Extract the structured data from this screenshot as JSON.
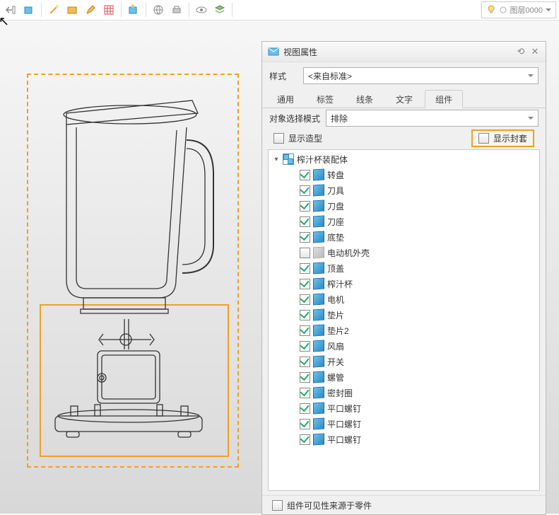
{
  "layer": {
    "label": "图层0000"
  },
  "panel": {
    "title": "视图属性",
    "style_label": "样式",
    "style_value": "<来自标准>",
    "tabs": [
      "通用",
      "标签",
      "线条",
      "文字",
      "组件"
    ],
    "active_tab": 4,
    "mode_label": "对象选择模式",
    "mode_value": "排除",
    "show_model": "显示造型",
    "show_envelope": "显示封套",
    "footer": "组件可见性来源于零件"
  },
  "tree": {
    "root": "榨汁杯装配体",
    "items": [
      {
        "label": "转盘",
        "checked": true
      },
      {
        "label": "刀具",
        "checked": true
      },
      {
        "label": "刀盘",
        "checked": true
      },
      {
        "label": "刀座",
        "checked": true
      },
      {
        "label": "底垫",
        "checked": true
      },
      {
        "label": "电动机外壳",
        "checked": false
      },
      {
        "label": "顶盖",
        "checked": true
      },
      {
        "label": "榨汁杯",
        "checked": true
      },
      {
        "label": "电机",
        "checked": true
      },
      {
        "label": "垫片",
        "checked": true
      },
      {
        "label": "垫片2",
        "checked": true
      },
      {
        "label": "风扇",
        "checked": true
      },
      {
        "label": "开关",
        "checked": true
      },
      {
        "label": "螺管",
        "checked": true
      },
      {
        "label": "密封圈",
        "checked": true
      },
      {
        "label": "平口螺钉",
        "checked": true
      },
      {
        "label": "平口螺钉",
        "checked": true
      },
      {
        "label": "平口螺钉",
        "checked": true
      }
    ]
  }
}
